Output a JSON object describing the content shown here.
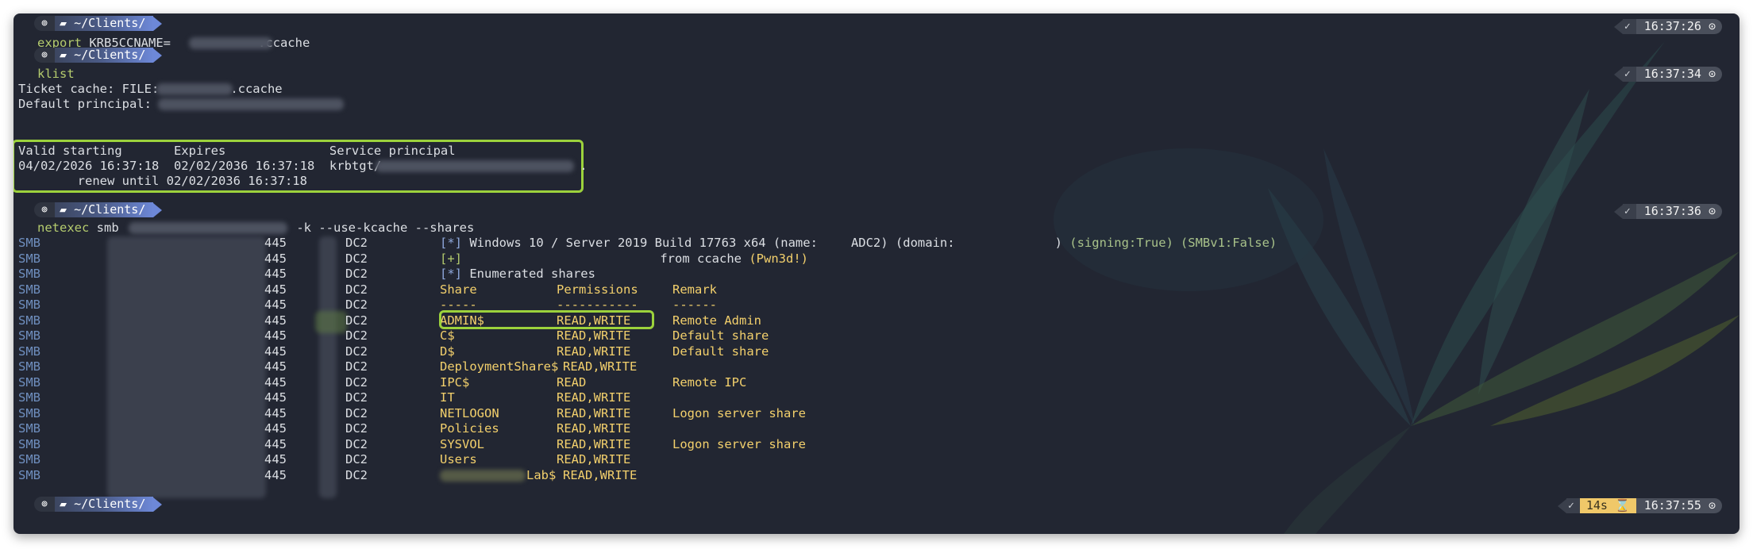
{
  "terminal": {
    "prompt_logo": "⊚",
    "prompt_folder_icon": "▰",
    "prompt_dir": "~/Clients/",
    "check_icon": "✓",
    "clock_icon": "⊙",
    "hourglass_icon": "⌛"
  },
  "block1": {
    "time": "16:37:26",
    "cmd_export": "export",
    "cmd_var": " KRB5CCNAME=",
    "cmd_suffix": ".ccache"
  },
  "block2": {
    "time": "16:37:34",
    "cmd": "klist",
    "cache_label": "Ticket cache: FILE:",
    "cache_suffix": ".ccache",
    "principal_label": "Default principal: ",
    "header": "Valid starting       Expires              Service principal",
    "row1_start": "04/02/2026 16:37:18  02/02/2036 16:37:18  krbtgt/",
    "row1_end": ".",
    "row2": "        renew until 02/02/2036 16:37:18"
  },
  "block3": {
    "time": "16:37:36",
    "cmd_name": "netexec",
    "cmd_args_a": " smb ",
    "cmd_args_b": " -k --use-kcache --shares",
    "proto": "SMB",
    "port": "445",
    "host": "DC2",
    "info_build_a": " Windows 10 / Server 2019 Build 17763 x64 (name:",
    "info_build_b": "ADC2) (domain:",
    "info_build_c": ") ",
    "signing": "(signing:True)",
    "smbv1": "(SMBv1:False)",
    "ccache_text": " from ccache ",
    "pwned": "(Pwn3d!)",
    "enumerated": " Enumerated shares",
    "tags": {
      "star": "[*]",
      "plus": "[+]"
    },
    "share_header": {
      "share": "Share",
      "perm": "Permissions",
      "remark": "Remark"
    },
    "share_sep": {
      "share": "-----",
      "perm": "-----------",
      "remark": "------"
    },
    "shares": [
      {
        "share": "ADMIN$",
        "perm": "READ,WRITE",
        "remark": "Remote Admin"
      },
      {
        "share": "C$",
        "perm": "READ,WRITE",
        "remark": "Default share"
      },
      {
        "share": "D$",
        "perm": "READ,WRITE",
        "remark": "Default share"
      },
      {
        "share": "DeploymentShare$",
        "perm": "READ,WRITE",
        "remark": ""
      },
      {
        "share": "IPC$",
        "perm": "READ",
        "remark": "Remote IPC"
      },
      {
        "share": "IT",
        "perm": "READ,WRITE",
        "remark": ""
      },
      {
        "share": "NETLOGON",
        "perm": "READ,WRITE",
        "remark": "Logon server share"
      },
      {
        "share": "Policies",
        "perm": "READ,WRITE",
        "remark": ""
      },
      {
        "share": "SYSVOL",
        "perm": "READ,WRITE",
        "remark": "Logon server share"
      },
      {
        "share": "Users",
        "perm": "READ,WRITE",
        "remark": ""
      }
    ],
    "last_share_suffix": "Lab$",
    "last_share_perm": "READ,WRITE"
  },
  "block4": {
    "duration": "14s",
    "time": "16:37:55"
  },
  "colors": {
    "background": "#222632",
    "highlight_box": "#9cd23c",
    "command": "#b5cc6e",
    "share_yellow": "#f3d06c",
    "smb_proto": "#6f8fbf",
    "prompt_blue": "#6d88d8",
    "duration_bg": "#f0c869"
  }
}
